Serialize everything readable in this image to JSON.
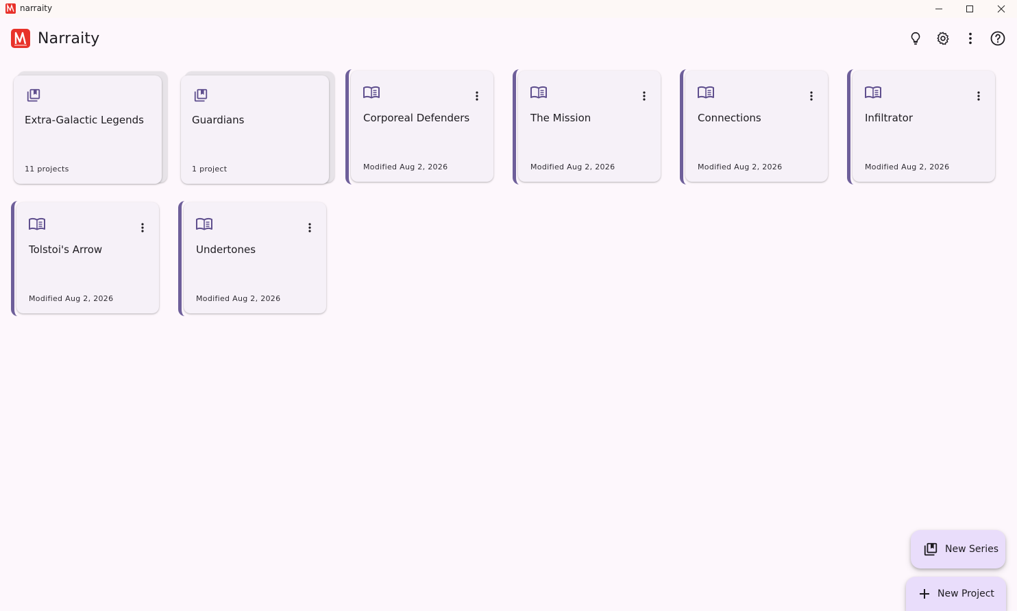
{
  "window": {
    "title": "narraity",
    "controls": [
      "minimize-icon",
      "maximize-icon",
      "close-icon"
    ]
  },
  "appbar": {
    "brand": "Narraity",
    "actions": [
      "lightbulb-icon",
      "settings-gear-icon",
      "more-vert-icon",
      "help-icon"
    ]
  },
  "series": [
    {
      "title": "Extra-Galactic Legends",
      "meta": "11 projects",
      "icon": "library-books-icon"
    },
    {
      "title": "Guardians",
      "meta": "1 project",
      "icon": "library-books-icon"
    }
  ],
  "projects": [
    {
      "title": "Corporeal Defenders",
      "meta": "Modified Aug 2, 2026",
      "icon": "open-book-icon"
    },
    {
      "title": "The Mission",
      "meta": "Modified Aug 2, 2026",
      "icon": "open-book-icon"
    },
    {
      "title": "Connections",
      "meta": "Modified Aug 2, 2026",
      "icon": "open-book-icon"
    },
    {
      "title": "Infiltrator",
      "meta": "Modified Aug 2, 2026",
      "icon": "open-book-icon"
    },
    {
      "title": "Tolstoi's Arrow",
      "meta": "Modified Aug 2, 2026",
      "icon": "open-book-icon"
    },
    {
      "title": "Undertones",
      "meta": "Modified Aug 2, 2026",
      "icon": "open-book-icon"
    }
  ],
  "fabs": {
    "new_series": "New Series",
    "new_project": "New Project"
  },
  "colors": {
    "brand_red": "#e8322a",
    "accent_purple": "#6e5f9a",
    "card_bg": "#f6f1f8",
    "fab_bg": "#e9ddfb",
    "page_bg": "#fdf7fc"
  }
}
